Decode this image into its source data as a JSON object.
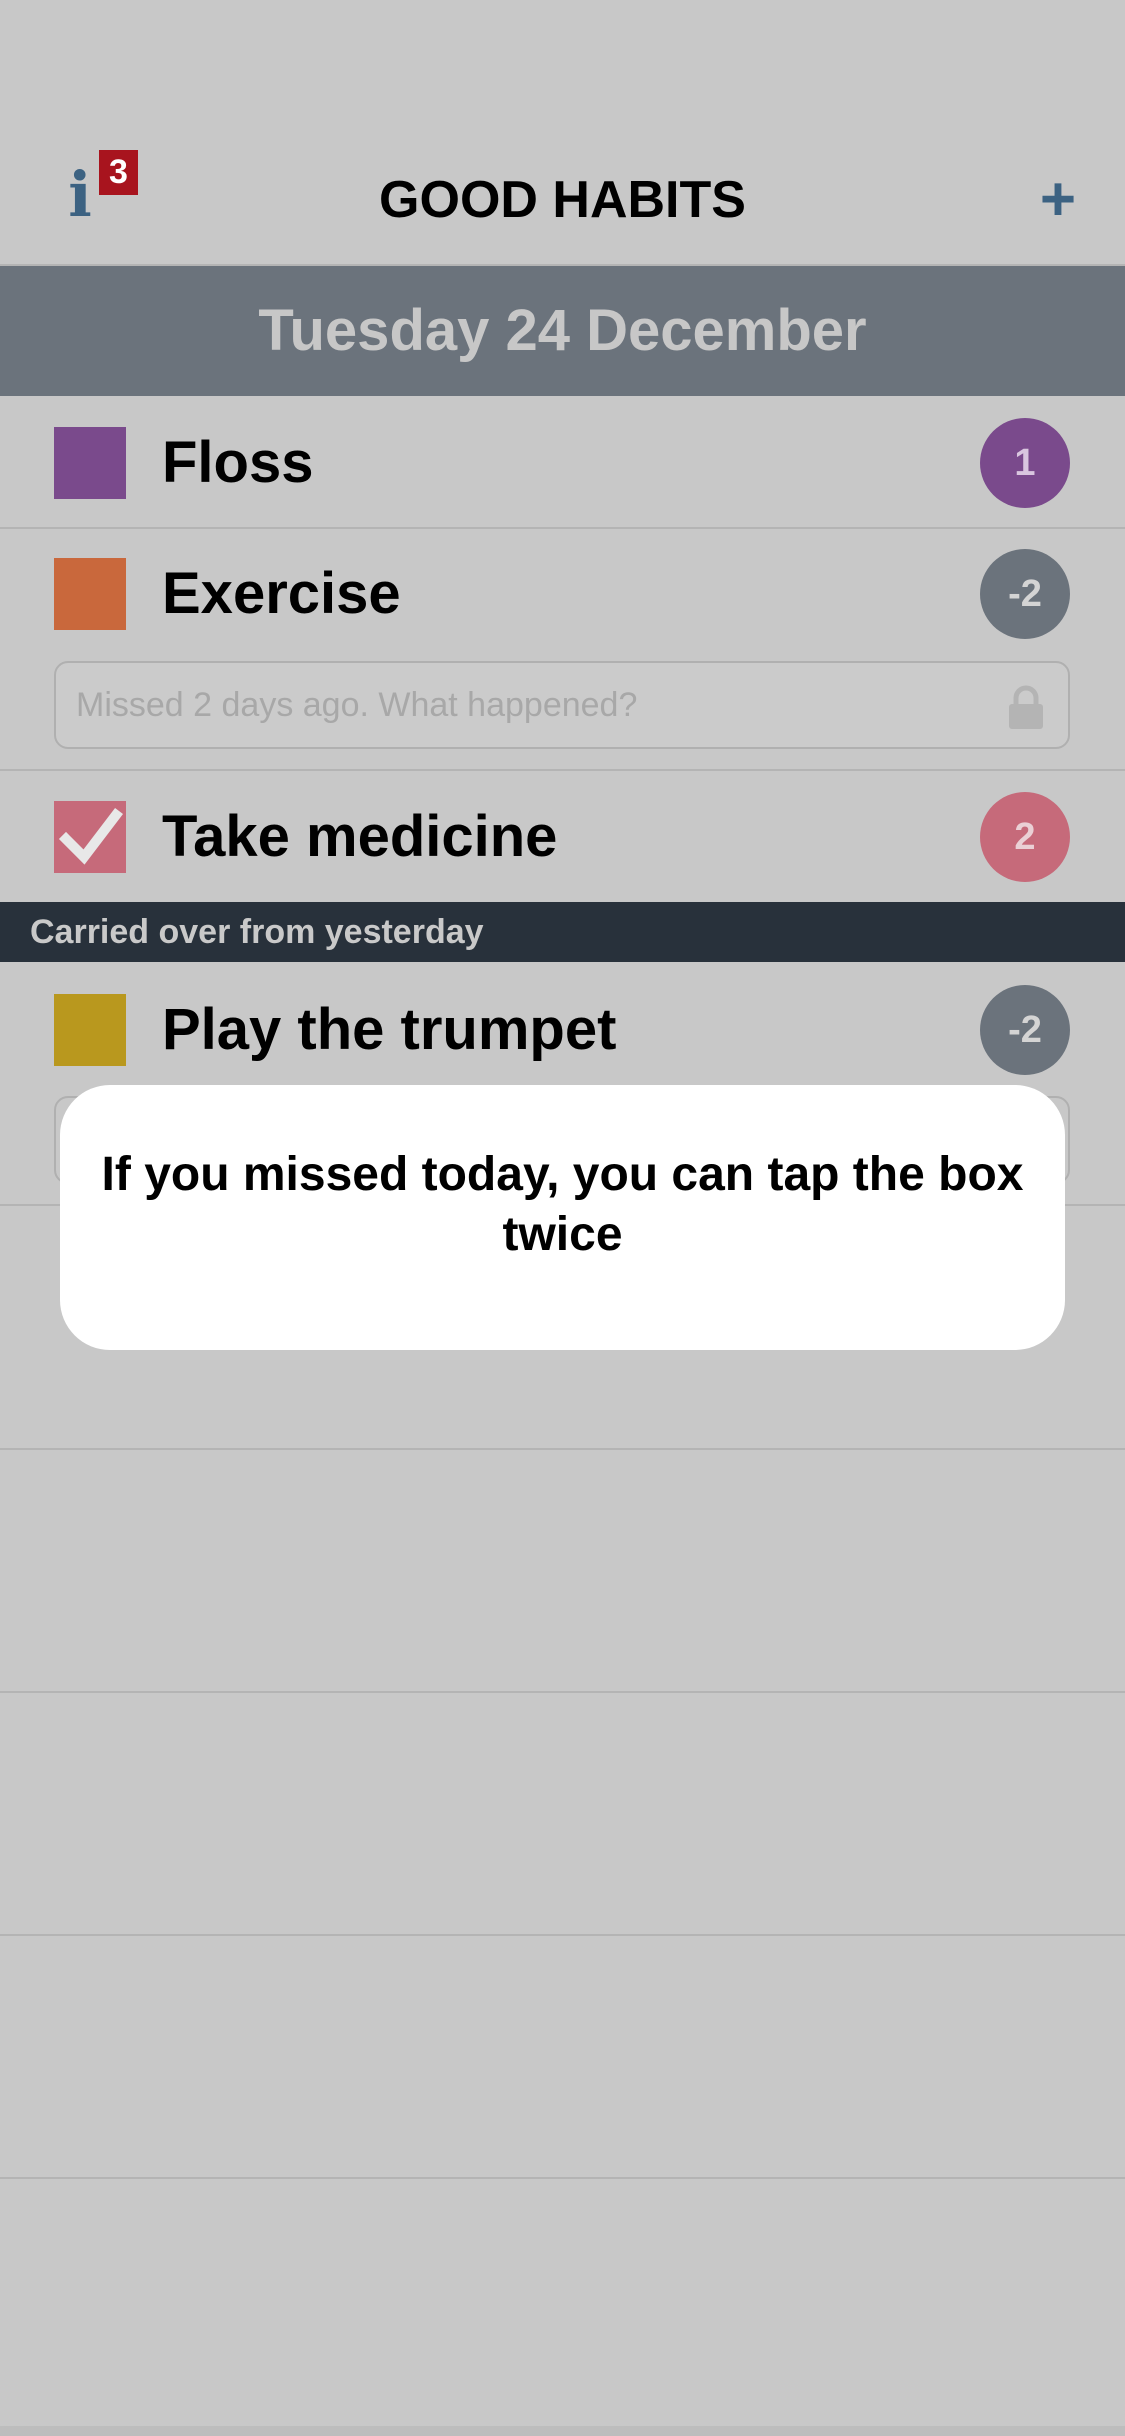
{
  "header": {
    "title": "GOOD HABITS",
    "info_icon": "i",
    "info_badge": "3",
    "add_icon": "+"
  },
  "date": "Tuesday 24 December",
  "habits": [
    {
      "name": "Floss",
      "color": "#7a4a8c",
      "score": "1",
      "score_color": "#7a4a8c",
      "checked": false
    },
    {
      "name": "Exercise",
      "color": "#c9683c",
      "score": "-2",
      "score_color": "#6b737c",
      "checked": false,
      "note_placeholder": "Missed 2 days ago. What happened?"
    },
    {
      "name": "Take medicine",
      "color": "#c66a7a",
      "score": "2",
      "score_color": "#c66a7a",
      "checked": true
    }
  ],
  "carried_over": {
    "label": "Carried over from yesterday",
    "habits": [
      {
        "name": "Play the trumpet",
        "color": "#b9981e",
        "score": "-2",
        "score_color": "#6b737c"
      }
    ]
  },
  "popup": {
    "text": "If you missed today, you can tap the box twice"
  }
}
